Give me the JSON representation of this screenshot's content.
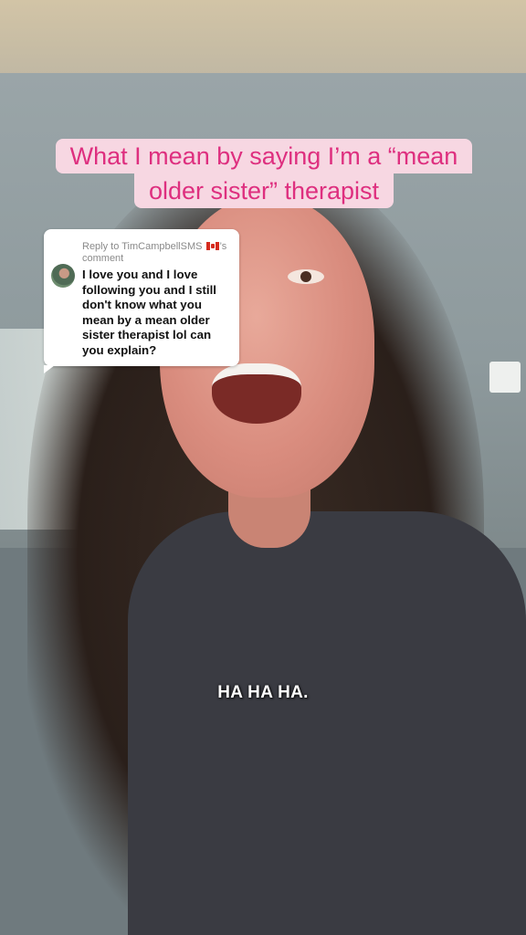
{
  "overlay_title": {
    "line1": "What I mean by saying I’m a “mean",
    "line2": "older sister” therapist"
  },
  "reply_card": {
    "prefix": "Reply to",
    "username": "TimCampbellSMS",
    "flag_icon": "canada-flag-icon",
    "suffix": "’s comment",
    "comment": "I love you and I love following you and I still don't know what you mean by a mean older sister therapist lol can you explain?"
  },
  "caption": "HA HA HA."
}
